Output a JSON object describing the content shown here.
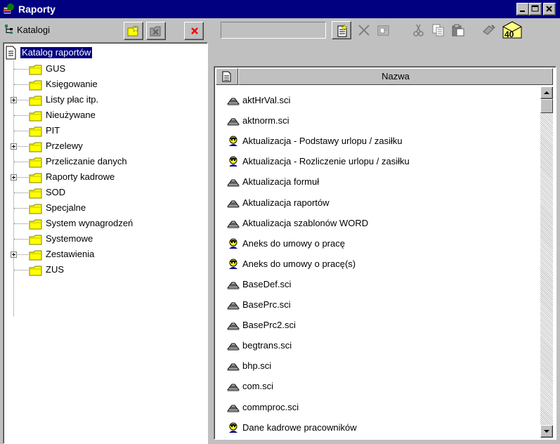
{
  "window": {
    "title": "Raporty",
    "icon": "raporty-app-icon",
    "controls": [
      "minimize-icon",
      "maximize-icon",
      "close-icon"
    ]
  },
  "left_toolbar": {
    "label": "Katalogi",
    "icon": "tree-icon",
    "buttons": [
      "new-folder-icon",
      "delete-folder-icon",
      "close-panel-icon"
    ]
  },
  "right_toolbar": {
    "combo_value": "",
    "buttons": [
      "new-report-icon",
      "delete-icon",
      "properties-icon",
      "cut-icon",
      "copy-icon",
      "paste-icon",
      "edit-icon",
      "pit-40-icon"
    ]
  },
  "tree": {
    "root": "Katalog raportów",
    "items": [
      {
        "label": "GUS",
        "expandable": false
      },
      {
        "label": "Księgowanie",
        "expandable": false
      },
      {
        "label": "Listy płac itp.",
        "expandable": true
      },
      {
        "label": "Nieużywane",
        "expandable": false
      },
      {
        "label": "PIT",
        "expandable": false
      },
      {
        "label": "Przelewy",
        "expandable": true
      },
      {
        "label": "Przeliczanie danych",
        "expandable": false
      },
      {
        "label": "Raporty kadrowe",
        "expandable": true
      },
      {
        "label": "SOD",
        "expandable": false
      },
      {
        "label": "Specjalne",
        "expandable": false
      },
      {
        "label": "System wynagrodzeń",
        "expandable": false
      },
      {
        "label": "Systemowe",
        "expandable": false
      },
      {
        "label": "Zestawienia",
        "expandable": true
      },
      {
        "label": "ZUS",
        "expandable": false
      }
    ]
  },
  "list": {
    "header": "Nazwa",
    "rows": [
      {
        "label": "aktHrVal.sci",
        "icon": "script-icon"
      },
      {
        "label": "aktnorm.sci",
        "icon": "script-icon"
      },
      {
        "label": "Aktualizacja - Podstawy urlopu / zasiłku",
        "icon": "person-report-icon"
      },
      {
        "label": "Aktualizacja - Rozliczenie urlopu / zasiłku",
        "icon": "person-report-icon"
      },
      {
        "label": "Aktualizacja formuł",
        "icon": "script-icon"
      },
      {
        "label": "Aktualizacja raportów",
        "icon": "script-icon"
      },
      {
        "label": "Aktualizacja szablonów WORD",
        "icon": "script-icon"
      },
      {
        "label": "Aneks do umowy o pracę",
        "icon": "person-report-icon"
      },
      {
        "label": "Aneks do umowy o pracę(s)",
        "icon": "person-report-icon"
      },
      {
        "label": "BaseDef.sci",
        "icon": "script-icon"
      },
      {
        "label": "BasePrc.sci",
        "icon": "script-icon"
      },
      {
        "label": "BasePrc2.sci",
        "icon": "script-icon"
      },
      {
        "label": "begtrans.sci",
        "icon": "script-icon"
      },
      {
        "label": "bhp.sci",
        "icon": "script-icon"
      },
      {
        "label": "com.sci",
        "icon": "script-icon"
      },
      {
        "label": "commproc.sci",
        "icon": "script-icon"
      },
      {
        "label": "Dane kadrowe pracowników",
        "icon": "person-report-icon"
      }
    ]
  }
}
